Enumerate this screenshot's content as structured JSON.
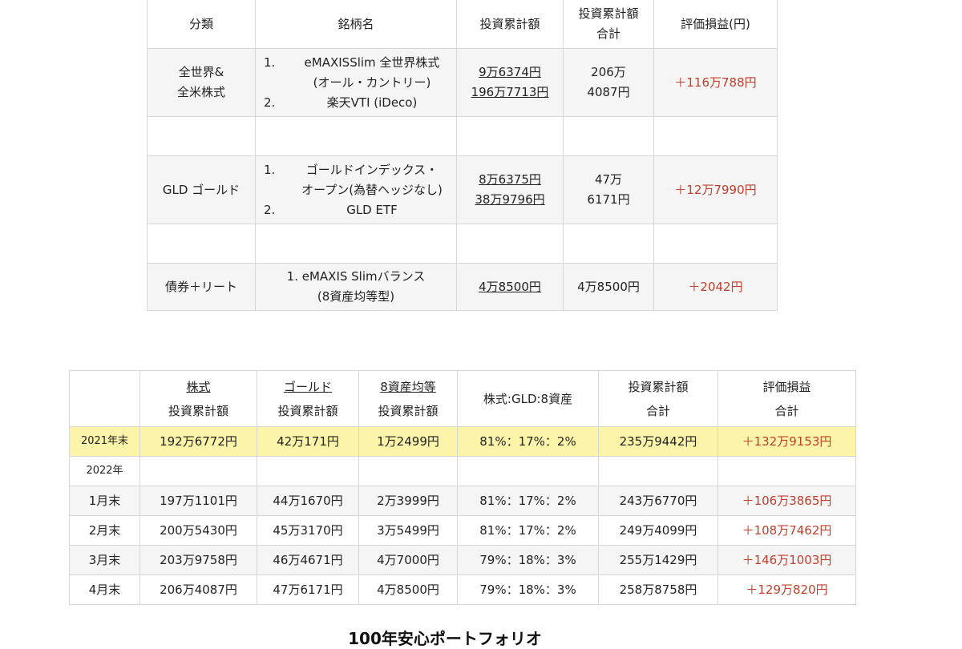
{
  "top_table": {
    "headers": [
      "分類",
      "銘柄名",
      "投資累計額",
      "投資累計額\n合計",
      "評価損益(円)"
    ],
    "rows": [
      {
        "category": "全世界&\n全米株式",
        "items": [
          {
            "num": "1.",
            "name": "eMAXISSlim 全世界株式\n(オール・カントリー)"
          },
          {
            "num": "2.",
            "name": "楽天VTI (iDeco)"
          }
        ],
        "amounts": [
          "9万6374円",
          "196万7713円"
        ],
        "total": "206万\n4087円",
        "pl": "＋116万788円"
      },
      {
        "category": "GLD ゴールド",
        "items": [
          {
            "num": "1.",
            "name": "ゴールドインデックス・\nオープン(為替ヘッジなし)"
          },
          {
            "num": "2.",
            "name": "GLD ETF"
          }
        ],
        "amounts": [
          "8万6375円",
          "38万9796円"
        ],
        "total": "47万\n6171円",
        "pl": "＋12万7990円"
      },
      {
        "category": "債券＋リート",
        "items": [
          {
            "num": "",
            "name": "1. eMAXIS Slimバランス\n(8資産均等型)"
          }
        ],
        "amounts": [
          "4万8500円"
        ],
        "total": "4万8500円",
        "pl": "＋2042円"
      }
    ]
  },
  "history_table": {
    "headers": [
      {
        "main": "株式",
        "sub": "投資累計額"
      },
      {
        "main": "ゴールド",
        "sub": "投資累計額"
      },
      {
        "main": "8資産均等",
        "sub": "投資累計額"
      },
      {
        "main": "株式:GLD:8資産",
        "sub": ""
      },
      {
        "main": "投資累計額",
        "sub": "合計"
      },
      {
        "main": "評価損益",
        "sub": "合計"
      }
    ],
    "rows": [
      {
        "label": "2021年末",
        "stock": "192万6772円",
        "gold": "42万171円",
        "bal": "1万2499円",
        "ratio": "81%：17%：2%",
        "total": "235万9442円",
        "pl": "＋132万9153円"
      },
      {
        "label": "2022年"
      },
      {
        "label": "1月末",
        "stock": "197万1101円",
        "gold": "44万1670円",
        "bal": "2万3999円",
        "ratio": "81%：17%：2%",
        "total": "243万6770円",
        "pl": "＋106万3865円"
      },
      {
        "label": "2月末",
        "stock": "200万5430円",
        "gold": "45万3170円",
        "bal": "3万5499円",
        "ratio": "81%：17%：2%",
        "total": "249万4099円",
        "pl": "＋108万7462円"
      },
      {
        "label": "3月末",
        "stock": "203万9758円",
        "gold": "46万4671円",
        "bal": "4万7000円",
        "ratio": "79%：18%：3%",
        "total": "255万1429円",
        "pl": "＋146万1003円"
      },
      {
        "label": "4月末",
        "stock": "206万4087円",
        "gold": "47万6171円",
        "bal": "4万8500円",
        "ratio": "79%：18%：3%",
        "total": "258万8758円",
        "pl": "＋129万820円"
      }
    ]
  },
  "caption": "100年安心ポートフォリオ",
  "colors": {
    "profit": "#c0402d",
    "highlight": "#fcf5a9",
    "shade": "#f5f5f5",
    "border": "#d6d6d6"
  }
}
